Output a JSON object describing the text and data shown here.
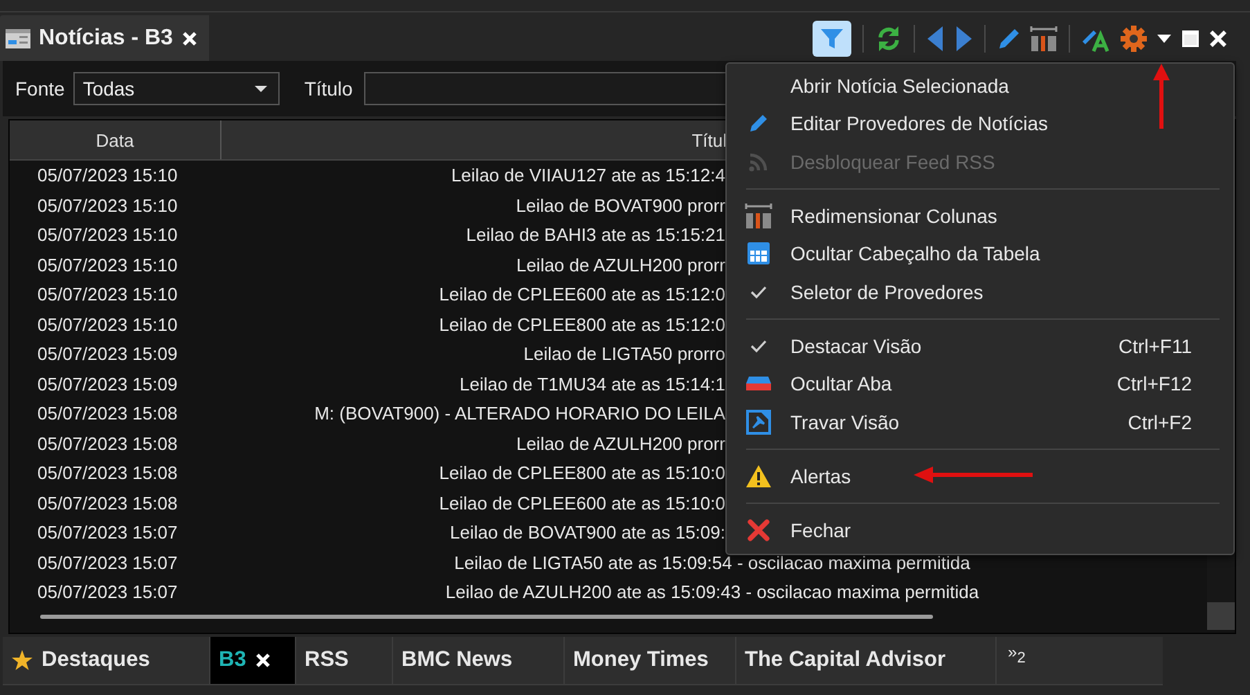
{
  "window": {
    "title": "Notícias - B3"
  },
  "toolbar": {
    "filter_on": true
  },
  "filter": {
    "source_label": "Fonte",
    "source_value": "Todas",
    "title_label": "Título"
  },
  "table": {
    "columns": [
      "Data",
      "Títul"
    ],
    "rows": [
      {
        "date": "05/07/2023 15:10",
        "title": "Leilao de VIIAU127 ate as 15:12:4"
      },
      {
        "date": "05/07/2023 15:10",
        "title": "Leilao de BOVAT900 prorr"
      },
      {
        "date": "05/07/2023 15:10",
        "title": "Leilao de BAHI3 ate as 15:15:21"
      },
      {
        "date": "05/07/2023 15:10",
        "title": "Leilao de AZULH200 prorr"
      },
      {
        "date": "05/07/2023 15:10",
        "title": "Leilao de CPLEE600 ate as 15:12:0"
      },
      {
        "date": "05/07/2023 15:10",
        "title": "Leilao de CPLEE800 ate as 15:12:0"
      },
      {
        "date": "05/07/2023 15:09",
        "title": "Leilao de LIGTA50 prorro"
      },
      {
        "date": "05/07/2023 15:09",
        "title": "Leilao de T1MU34 ate as 15:14:1"
      },
      {
        "date": "05/07/2023 15:08",
        "title": "M: (BOVAT900) - ALTERADO HORARIO DO LEILA"
      },
      {
        "date": "05/07/2023 15:08",
        "title": "Leilao de AZULH200 prorr"
      },
      {
        "date": "05/07/2023 15:08",
        "title": "Leilao de CPLEE800 ate as 15:10:0"
      },
      {
        "date": "05/07/2023 15:08",
        "title": "Leilao de CPLEE600 ate as 15:10:0"
      },
      {
        "date": "05/07/2023 15:07",
        "title": "Leilao de BOVAT900 ate as 15:09:"
      },
      {
        "date": "05/07/2023 15:07",
        "title": "Leilao de LIGTA50 ate as 15:09:54 - oscilacao maxima permitida"
      },
      {
        "date": "05/07/2023 15:07",
        "title": "Leilao de AZULH200 ate as 15:09:43 - oscilacao maxima permitida"
      }
    ]
  },
  "menu": {
    "groups": [
      [
        {
          "label": "Abrir Notícia Selecionada",
          "checked": false,
          "disabled": false
        },
        {
          "label": "Editar Provedores de Notícias",
          "checked": false,
          "disabled": false
        },
        {
          "label": "Desbloquear Feed RSS",
          "checked": false,
          "disabled": true
        }
      ],
      [
        {
          "label": "Redimensionar Colunas",
          "checked": false,
          "disabled": false
        },
        {
          "label": "Ocultar Cabeçalho da Tabela",
          "checked": false,
          "disabled": false
        },
        {
          "label": "Seletor de Provedores",
          "checked": true,
          "disabled": false
        }
      ],
      [
        {
          "label": "Destacar Visão",
          "shortcut": "Ctrl+F11",
          "checked": true,
          "disabled": false
        },
        {
          "label": "Ocultar Aba",
          "shortcut": "Ctrl+F12",
          "checked": false,
          "disabled": false
        },
        {
          "label": "Travar Visão",
          "shortcut": "Ctrl+F2",
          "checked": false,
          "disabled": false
        }
      ],
      [
        {
          "label": "Alertas",
          "checked": false,
          "disabled": false
        }
      ],
      [
        {
          "label": "Fechar",
          "checked": false,
          "disabled": false
        }
      ]
    ]
  },
  "bottom_tabs": [
    {
      "label": "Destaques",
      "kind": "favorite",
      "selected": false
    },
    {
      "label": "B3",
      "kind": "closable",
      "selected": true
    },
    {
      "label": "RSS",
      "kind": "plain",
      "selected": false
    },
    {
      "label": "BMC News",
      "kind": "plain",
      "selected": false
    },
    {
      "label": "Money Times",
      "kind": "plain",
      "selected": false
    },
    {
      "label": "The Capital Advisor",
      "kind": "plain",
      "selected": false
    }
  ],
  "overflow": {
    "glyph": "»",
    "count": "2"
  }
}
